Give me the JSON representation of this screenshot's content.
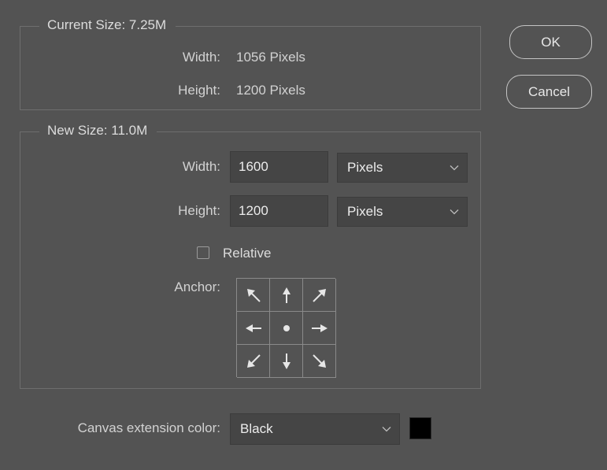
{
  "current_size": {
    "legend": "Current Size: 7.25M",
    "width_label": "Width:",
    "width_value": "1056 Pixels",
    "height_label": "Height:",
    "height_value": "1200 Pixels"
  },
  "new_size": {
    "legend": "New Size: 11.0M",
    "width_label": "Width:",
    "width_value": "1600",
    "width_unit": "Pixels",
    "height_label": "Height:",
    "height_value": "1200",
    "height_unit": "Pixels",
    "relative_label": "Relative",
    "relative_checked": false,
    "anchor_label": "Anchor:",
    "anchor_cells": [
      "arrow-up-left-icon",
      "arrow-up-icon",
      "arrow-up-right-icon",
      "arrow-left-icon",
      "anchor-center-dot-icon",
      "arrow-right-icon",
      "arrow-down-left-icon",
      "arrow-down-icon",
      "arrow-down-right-icon"
    ]
  },
  "extension": {
    "label": "Canvas extension color:",
    "value": "Black",
    "swatch_color": "#000000"
  },
  "buttons": {
    "ok": "OK",
    "cancel": "Cancel"
  },
  "colors": {
    "background": "#535353",
    "field": "#454545",
    "border": "#6e6e6e"
  }
}
